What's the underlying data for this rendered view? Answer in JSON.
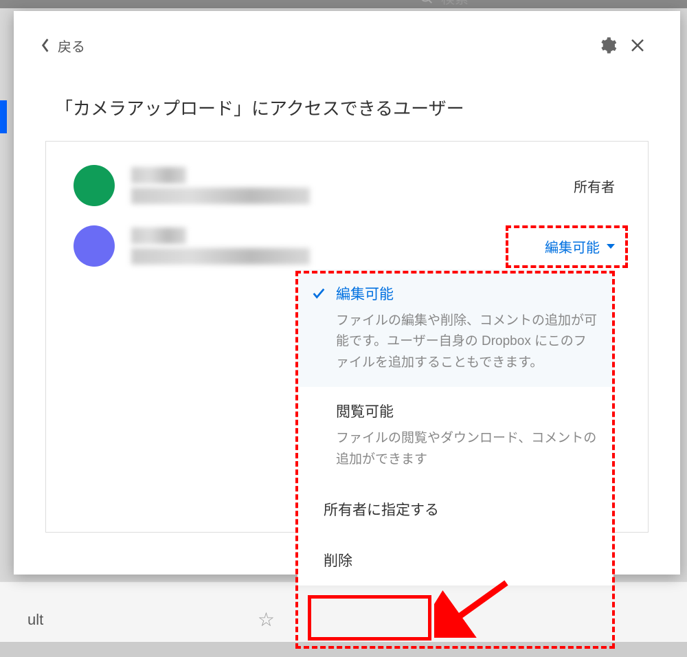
{
  "background": {
    "search_placeholder": "検索",
    "bottom_text": "ult"
  },
  "modal": {
    "back_label": "戻る",
    "title": "「カメラアップロード」にアクセスできるユーザー",
    "users": [
      {
        "avatar_color": "green",
        "role": "所有者"
      },
      {
        "avatar_color": "purple",
        "permission_label": "編集可能"
      }
    ]
  },
  "dropdown": {
    "options": [
      {
        "title": "編集可能",
        "desc": "ファイルの編集や削除、コメントの追加が可能です。ユーザー自身の Dropbox にこのファイルを追加することもできます。",
        "selected": true
      },
      {
        "title": "閲覧可能",
        "desc": "ファイルの閲覧やダウンロード、コメントの追加ができます",
        "selected": false
      },
      {
        "title": "所有者に指定する",
        "simple": true
      },
      {
        "title": "削除",
        "simple": true,
        "delete": true
      }
    ]
  },
  "colors": {
    "accent": "#0070e0",
    "highlight": "#f00"
  }
}
